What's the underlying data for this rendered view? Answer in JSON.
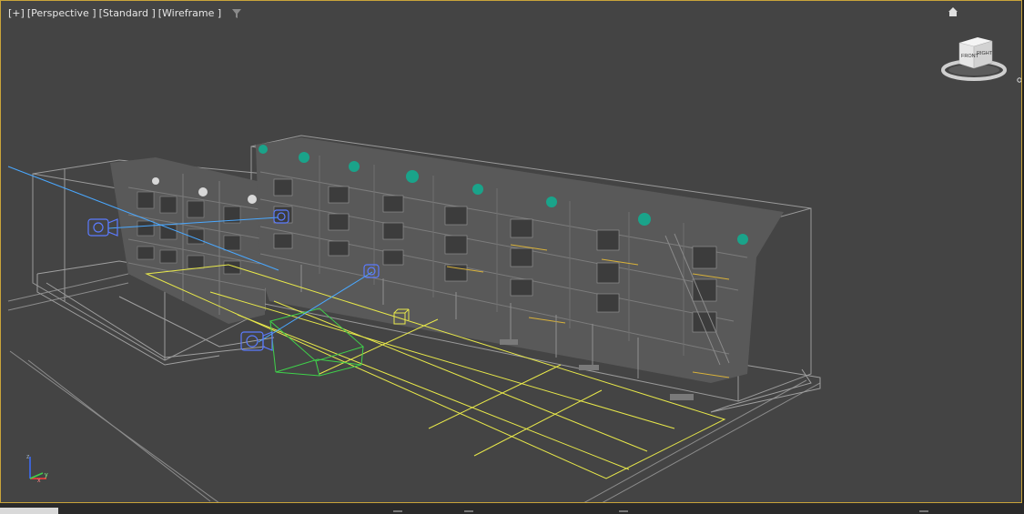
{
  "viewport": {
    "label_plus": "[+]",
    "label_view": "[Perspective ]",
    "label_shading": "[Standard ]",
    "label_mode": "[Wireframe ]",
    "filter_icon": "filter-icon",
    "background": "#444444",
    "border_color": "#c9a43a"
  },
  "viewcube": {
    "face_front": "FRONT",
    "face_right": "RIGHT",
    "home_icon": "home-icon"
  },
  "colors": {
    "building_fill": "#5a5a5a",
    "wire_gray": "#9a9a9a",
    "wire_yellow": "#e8e84a",
    "wire_green": "#3fd14a",
    "camera_blue": "#5b7bff",
    "target_line": "#4aa8ff",
    "plant_green": "#1aa38a"
  },
  "axis": {
    "x": "x",
    "y": "y",
    "z": "z"
  }
}
